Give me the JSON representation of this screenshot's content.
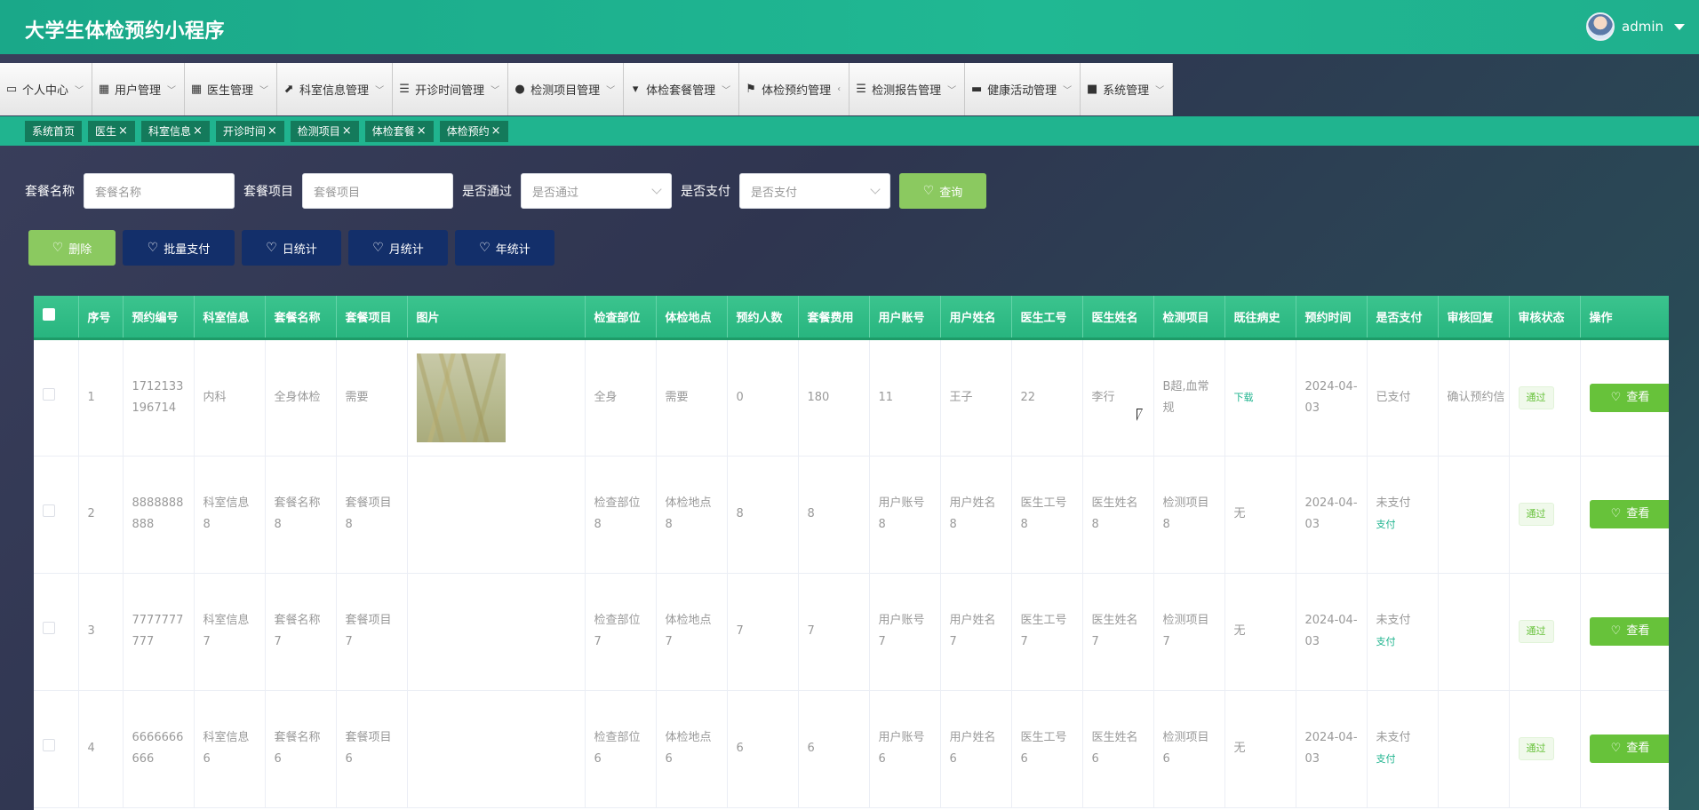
{
  "header": {
    "title": "大学生体检预约小程序",
    "user": "admin"
  },
  "nav": [
    {
      "label": "个人中心",
      "icon": "calendar-icon"
    },
    {
      "label": "用户管理",
      "icon": "grid-icon"
    },
    {
      "label": "医生管理",
      "icon": "grid-icon"
    },
    {
      "label": "科室信息管理",
      "icon": "chart-icon"
    },
    {
      "label": "开诊时间管理",
      "icon": "list-icon"
    },
    {
      "label": "检测项目管理",
      "icon": "bulb-icon"
    },
    {
      "label": "体检套餐管理",
      "icon": "stamp-icon"
    },
    {
      "label": "体检预约管理",
      "icon": "flag-icon"
    },
    {
      "label": "检测报告管理",
      "icon": "list-icon"
    },
    {
      "label": "健康活动管理",
      "icon": "chat-icon"
    },
    {
      "label": "系统管理",
      "icon": "briefcase-icon"
    }
  ],
  "tabs": [
    "系统首页",
    "医生",
    "科室信息",
    "开诊时间",
    "检测项目",
    "体检套餐",
    "体检预约"
  ],
  "search": {
    "f1": {
      "label": "套餐名称",
      "placeholder": "套餐名称"
    },
    "f2": {
      "label": "套餐项目",
      "placeholder": "套餐项目"
    },
    "f3": {
      "label": "是否通过",
      "placeholder": "是否通过"
    },
    "f4": {
      "label": "是否支付",
      "placeholder": "是否支付"
    },
    "query": "查询"
  },
  "actions": {
    "delete": "删除",
    "batch_pay": "批量支付",
    "day": "日统计",
    "month": "月统计",
    "year": "年统计"
  },
  "table": {
    "columns": [
      "序号",
      "预约编号",
      "科室信息",
      "套餐名称",
      "套餐项目",
      "图片",
      "检查部位",
      "体检地点",
      "预约人数",
      "套餐费用",
      "用户账号",
      "用户姓名",
      "医生工号",
      "医生姓名",
      "检测项目",
      "既往病史",
      "预约时间",
      "是否支付",
      "审核回复",
      "审核状态",
      "操作"
    ],
    "rows": [
      {
        "idx": "1",
        "no": "1712133196714",
        "dept": "内科",
        "pkg": "全身体检",
        "item": "需要",
        "part": "全身",
        "place": "需要",
        "count": "0",
        "fee": "180",
        "acct": "11",
        "uname": "王子",
        "docno": "22",
        "docname": "李行",
        "test": "B超,血常规",
        "history": "下载",
        "time": "2024-04-03",
        "paid": "已支付",
        "pay_link": "",
        "reply": "确认预约信",
        "status": "通过",
        "view": "查看"
      },
      {
        "idx": "2",
        "no": "8888888888",
        "dept": "科室信息8",
        "pkg": "套餐名称8",
        "item": "套餐项目8",
        "part": "检查部位8",
        "place": "体检地点8",
        "count": "8",
        "fee": "8",
        "acct": "用户账号8",
        "uname": "用户姓名8",
        "docno": "医生工号8",
        "docname": "医生姓名8",
        "test": "检测项目8",
        "history": "无",
        "time": "2024-04-03",
        "paid": "未支付",
        "pay_link": "支付",
        "reply": "",
        "status": "通过",
        "view": "查看"
      },
      {
        "idx": "3",
        "no": "7777777777",
        "dept": "科室信息7",
        "pkg": "套餐名称7",
        "item": "套餐项目7",
        "part": "检查部位7",
        "place": "体检地点7",
        "count": "7",
        "fee": "7",
        "acct": "用户账号7",
        "uname": "用户姓名7",
        "docno": "医生工号7",
        "docname": "医生姓名7",
        "test": "检测项目7",
        "history": "无",
        "time": "2024-04-03",
        "paid": "未支付",
        "pay_link": "支付",
        "reply": "",
        "status": "通过",
        "view": "查看"
      },
      {
        "idx": "4",
        "no": "6666666666",
        "dept": "科室信息6",
        "pkg": "套餐名称6",
        "item": "套餐项目6",
        "part": "检查部位6",
        "place": "体检地点6",
        "count": "6",
        "fee": "6",
        "acct": "用户账号6",
        "uname": "用户姓名6",
        "docno": "医生工号6",
        "docname": "医生姓名6",
        "test": "检测项目6",
        "history": "无",
        "time": "2024-04-03",
        "paid": "未支付",
        "pay_link": "支付",
        "reply": "",
        "status": "通过",
        "view": "查看"
      }
    ]
  }
}
